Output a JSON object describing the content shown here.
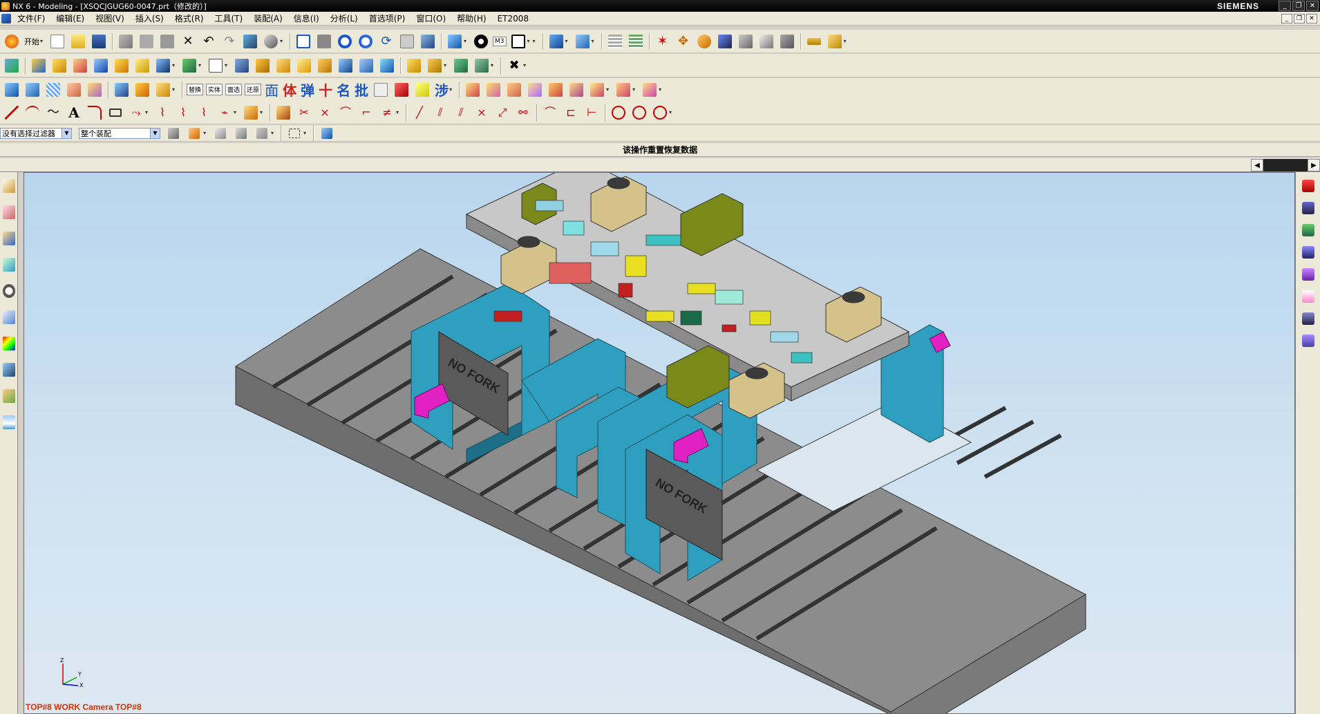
{
  "window": {
    "title": "NX 6 - Modeling - [XSQCJGUG60-0047.prt（修改的）]",
    "brand": "SIEMENS"
  },
  "menu": {
    "items": [
      "文件(F)",
      "编辑(E)",
      "视图(V)",
      "插入(S)",
      "格式(R)",
      "工具(T)",
      "装配(A)",
      "信息(I)",
      "分析(L)",
      "首选项(P)",
      "窗口(O)",
      "帮助(H)",
      "ET2008"
    ]
  },
  "toolbar1": {
    "start_label": "开始",
    "layer_label": "M3"
  },
  "toolbar3": {
    "text_buttons": [
      "替换",
      "实体",
      "面选",
      "还原"
    ],
    "cn_buttons": [
      "面",
      "体",
      "弹",
      "十",
      "名",
      "批"
    ],
    "cn_colors": [
      "#1a56c8",
      "#d02020",
      "#1a56c8",
      "#d02020",
      "#1a56c8",
      "#1a56c8"
    ],
    "step_label": "涉"
  },
  "selection": {
    "filter_value": "没有选择过滤器",
    "scope_value": "整个装配"
  },
  "status": {
    "message": "该操作重置恢复数据"
  },
  "viewport": {
    "view_label": "TOP#8 WORK Camera TOP#8",
    "model_text_1": "NO FORK",
    "model_text_2": "NO FORK",
    "triad_z": "Z",
    "triad_y": "Y",
    "triad_x": "X"
  },
  "colors": {
    "accent_cyan": "#2f9fc0",
    "base_gray": "#8a8a8a",
    "plate_gray": "#c8c8c8",
    "magenta": "#e020c0",
    "olive": "#7a8a1a",
    "label_red": "#e03000"
  }
}
